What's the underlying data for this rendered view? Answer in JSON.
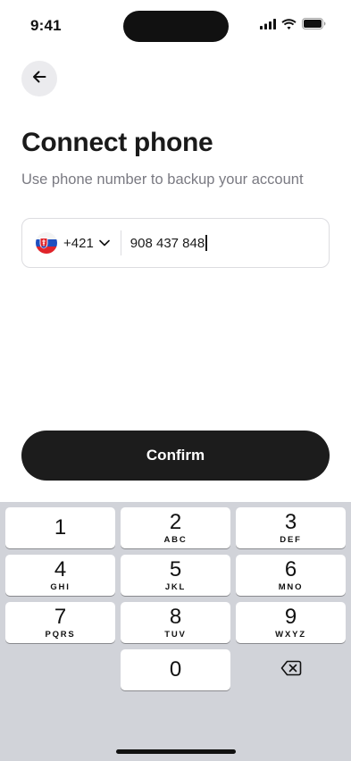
{
  "status_bar": {
    "time": "9:41"
  },
  "header": {
    "back_icon": "arrow-left-icon",
    "title": "Connect phone",
    "subtitle": "Use phone number to backup your account"
  },
  "phone_field": {
    "country_flag": "slovakia-flag-icon",
    "dial_code": "+421",
    "chevron_icon": "chevron-down-icon",
    "value": "908 437 848"
  },
  "confirm_button": {
    "label": "Confirm"
  },
  "keypad": {
    "keys": [
      {
        "digit": "1",
        "letters": ""
      },
      {
        "digit": "2",
        "letters": "ABC"
      },
      {
        "digit": "3",
        "letters": "DEF"
      },
      {
        "digit": "4",
        "letters": "GHI"
      },
      {
        "digit": "5",
        "letters": "JKL"
      },
      {
        "digit": "6",
        "letters": "MNO"
      },
      {
        "digit": "7",
        "letters": "PQRS"
      },
      {
        "digit": "8",
        "letters": "TUV"
      },
      {
        "digit": "9",
        "letters": "WXYZ"
      },
      {
        "digit": "0",
        "letters": ""
      }
    ],
    "delete_icon": "backspace-icon"
  },
  "colors": {
    "primary_button": "#1c1c1c",
    "keyboard_background": "#d1d3d9",
    "subtitle_text": "#7a7a82"
  }
}
